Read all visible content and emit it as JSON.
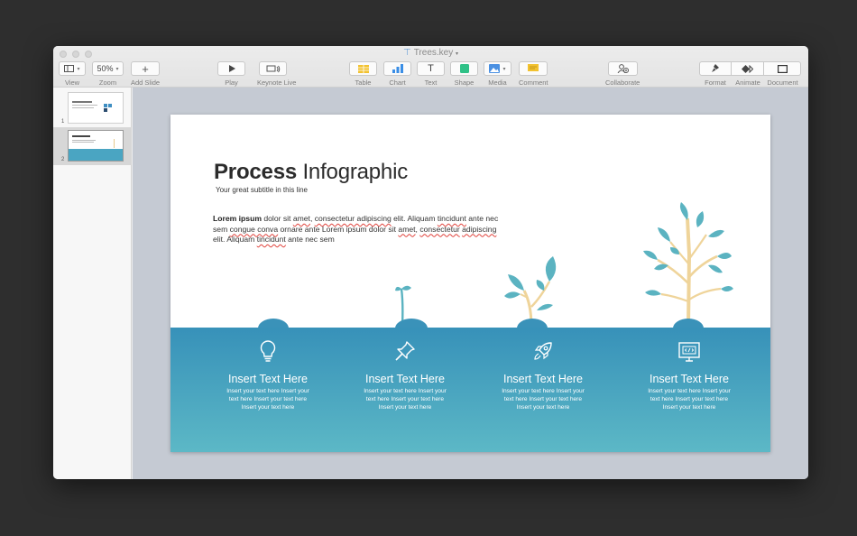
{
  "window": {
    "title": "Trees.key"
  },
  "toolbar": {
    "view": {
      "label": "View",
      "icon": "sidebar-view-icon"
    },
    "zoom": {
      "label": "Zoom",
      "value": "50%"
    },
    "add_slide": {
      "label": "Add Slide",
      "icon": "plus-icon"
    },
    "play": {
      "label": "Play",
      "icon": "play-icon"
    },
    "keynote_live": {
      "label": "Keynote Live",
      "icon": "broadcast-icon"
    },
    "table": {
      "label": "Table",
      "icon": "table-icon",
      "color": "#f2c230"
    },
    "chart": {
      "label": "Chart",
      "icon": "chart-icon",
      "color": "#3a8ee6"
    },
    "text": {
      "label": "Text",
      "icon": "text-icon",
      "glyph": "T"
    },
    "shape": {
      "label": "Shape",
      "icon": "shape-icon",
      "color": "#2fc187"
    },
    "media": {
      "label": "Media",
      "icon": "media-icon",
      "color": "#4a90e2"
    },
    "comment": {
      "label": "Comment",
      "icon": "comment-icon",
      "color": "#f2c230"
    },
    "collaborate": {
      "label": "Collaborate",
      "icon": "collaborate-icon"
    },
    "format": {
      "label": "Format",
      "icon": "paintbrush-icon"
    },
    "animate": {
      "label": "Animate",
      "icon": "animate-diamond-icon"
    },
    "document": {
      "label": "Document",
      "icon": "document-icon"
    }
  },
  "navigator": {
    "slides": [
      {
        "number": "1",
        "selected": false
      },
      {
        "number": "2",
        "selected": true
      }
    ]
  },
  "slide": {
    "title_bold": "Process",
    "title_rest": " Infographic",
    "subtitle": "Your great subtitle in this line",
    "body": {
      "lead": "Lorem ipsum",
      "p1": " dolor sit ",
      "w1": "amet",
      "p2": ", ",
      "w2": "consectetur adipiscing",
      "p3": " elit. Aliquam ",
      "w3": "tincidunt",
      "p4": " ante nec sem ",
      "w4": "congue conva",
      "p5": " ornare ante Lorem ipsum dolor sit ",
      "w5": "amet",
      "p6": ", ",
      "w6": "consectetur",
      "w7": "adipiscing",
      "p7": " elit. Aliquam ",
      "w8": "tincidunt",
      "p8": " ante nec sem"
    },
    "colors": {
      "ground": "#3791b9",
      "leaf": "#5bb3c1",
      "trunk": "#efd49a"
    },
    "steps": [
      {
        "icon": "lightbulb-icon",
        "heading": "Insert Text Here",
        "text": "Insert your text here Insert your text here Insert your text here Insert your text here"
      },
      {
        "icon": "pushpin-icon",
        "heading": "Insert Text Here",
        "text": "Insert your text here Insert your text here Insert your text here Insert your text here"
      },
      {
        "icon": "rocket-icon",
        "heading": "Insert Text Here",
        "text": "Insert your text here Insert your text here Insert your text here Insert your text here"
      },
      {
        "icon": "code-monitor-icon",
        "heading": "Insert Text Here",
        "text": "Insert your text here Insert your text here Insert your text here Insert your text here"
      }
    ]
  }
}
